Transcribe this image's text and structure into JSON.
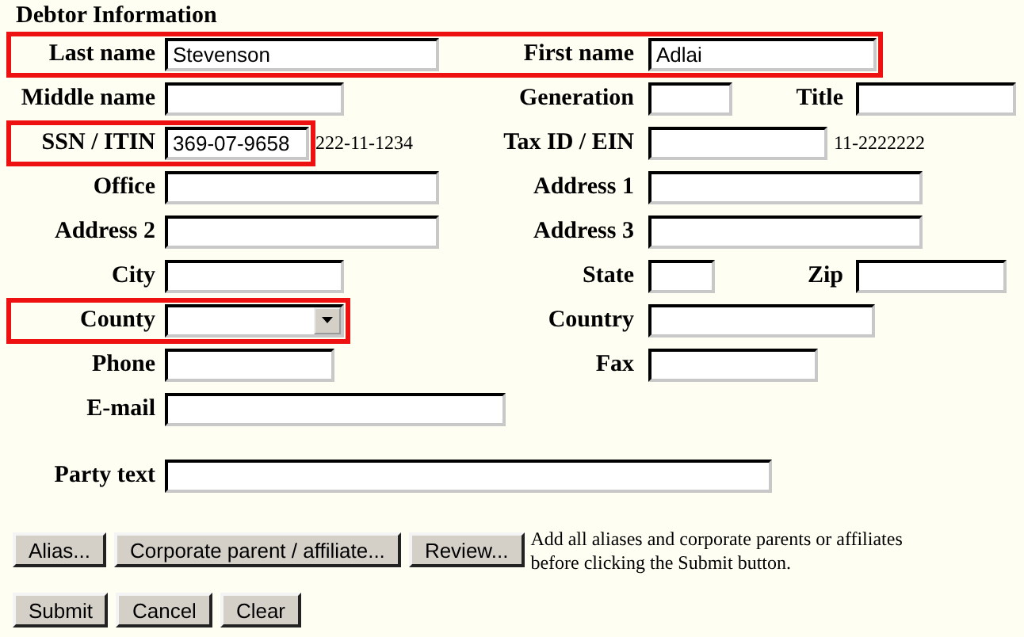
{
  "section_title": "Debtor Information",
  "rows": [
    {
      "fields": [
        {
          "kind": "text",
          "label": "Last name",
          "value": "Stevenson",
          "highlighted": true
        },
        {
          "kind": "text",
          "label": "First name",
          "value": "Adlai",
          "highlighted": true
        }
      ]
    },
    {
      "fields": [
        {
          "kind": "text",
          "label": "Middle name",
          "highlighted": false
        },
        {
          "kind": "text",
          "label": "Generation",
          "highlighted": false
        },
        {
          "kind": "text",
          "label": "Title",
          "highlighted": false
        }
      ]
    },
    {
      "fields": [
        {
          "kind": "text",
          "label": "SSN / ITIN",
          "value": "369-07-9658",
          "note": "222-11-1234",
          "highlighted": true
        },
        {
          "kind": "text",
          "label": "Tax ID / EIN",
          "note": "11-2222222",
          "highlighted": false
        }
      ]
    },
    {
      "fields": [
        {
          "kind": "text",
          "label": "Office",
          "highlighted": false
        },
        {
          "kind": "text",
          "label": "Address 1",
          "highlighted": false
        }
      ]
    },
    {
      "fields": [
        {
          "kind": "text",
          "label": "Address 2",
          "highlighted": false
        },
        {
          "kind": "text",
          "label": "Address 3",
          "highlighted": false
        }
      ]
    },
    {
      "fields": [
        {
          "kind": "text",
          "label": "City",
          "highlighted": false
        },
        {
          "kind": "text",
          "label": "State",
          "highlighted": false
        },
        {
          "kind": "text",
          "label": "Zip",
          "highlighted": false
        }
      ]
    },
    {
      "fields": [
        {
          "kind": "select",
          "label": "County",
          "highlighted": true
        },
        {
          "kind": "text",
          "label": "Country",
          "highlighted": false
        }
      ]
    },
    {
      "fields": [
        {
          "kind": "text",
          "label": "Phone",
          "highlighted": false
        },
        {
          "kind": "text",
          "label": "Fax",
          "highlighted": false
        }
      ]
    },
    {
      "fields": [
        {
          "kind": "text",
          "label": "E-mail",
          "highlighted": false
        }
      ]
    }
  ],
  "party_text": {
    "label": "Party text"
  },
  "action_buttons": [
    "Alias...",
    "Corporate parent / affiliate...",
    "Review..."
  ],
  "action_note": "Add all aliases and corporate parents or affiliates before clicking the Submit button.",
  "submit_buttons": [
    "Submit",
    "Cancel",
    "Clear"
  ]
}
